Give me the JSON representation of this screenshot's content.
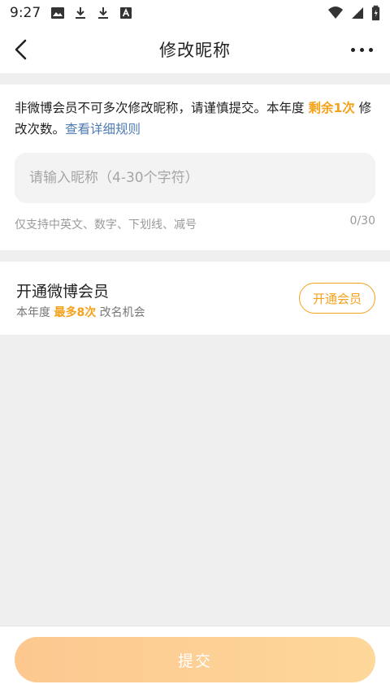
{
  "status_bar": {
    "time": "9:27",
    "left_icons": [
      "image-icon",
      "download-icon",
      "download-icon",
      "font-icon"
    ],
    "right_icons": [
      "wifi-icon",
      "signal-icon",
      "battery-icon"
    ]
  },
  "header": {
    "title": "修改昵称",
    "back_icon": "chevron-left-icon",
    "more_icon": "more-dots-icon"
  },
  "notice": {
    "text_before": "非微博会员不可多次修改昵称，请谨慎提交。本年度 ",
    "highlight": "剩余1次",
    "text_after": " 修改次数。",
    "link": "查看详细规则"
  },
  "nickname_input": {
    "value": "",
    "placeholder": "请输入昵称（4-30个字符）"
  },
  "hint": "仅支持中英文、数字、下划线、减号",
  "counter": "0/30",
  "vip": {
    "title": "开通微博会员",
    "sub_before": "本年度 ",
    "sub_highlight": "最多8次",
    "sub_after": " 改名机会",
    "button_label": "开通会员"
  },
  "submit_label": "提交",
  "colors": {
    "accent_orange": "#f5a21b",
    "link_blue": "#4f7bb3",
    "submit_gradient_start": "#fcc890",
    "submit_gradient_end": "#fed79a"
  }
}
